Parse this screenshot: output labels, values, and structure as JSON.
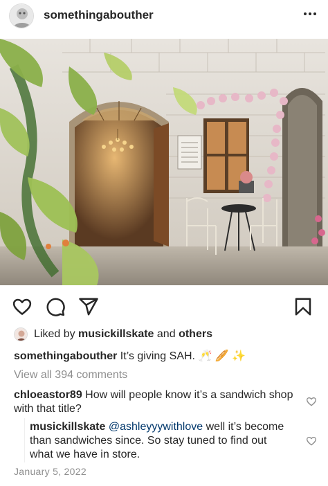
{
  "post": {
    "username": "somethingabouther",
    "more_icon": "more-horizontal-icon",
    "caption_text": "It’s giving SAH.",
    "caption_emojis": "🥂 🥖 ✨",
    "liked_by_prefix": "Liked by",
    "liked_by_user": "musickillskate",
    "liked_by_and": "and",
    "liked_by_others": "others",
    "view_all_comments": "View all 394 comments",
    "date": "January 5, 2022"
  },
  "comments": [
    {
      "user": "chloeastor89",
      "text": "How will people know it’s a sandwich shop with that title?"
    },
    {
      "user": "musickillskate",
      "mention": "@ashleyyywithlove",
      "text": "well it’s become than sandwiches since. So stay tuned to find out what we have in store."
    }
  ],
  "colors": {
    "text": "#262626",
    "muted": "#8e8e8e",
    "mention": "#00376b"
  }
}
